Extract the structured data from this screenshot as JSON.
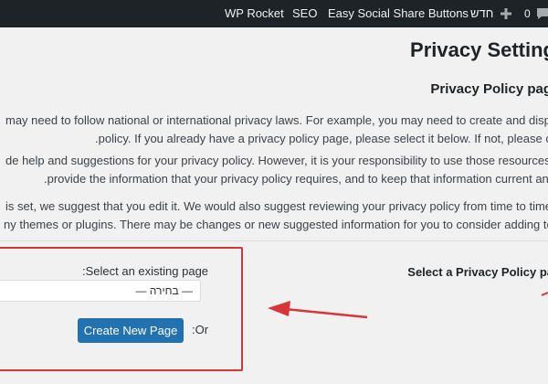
{
  "adminbar": {
    "items": [
      "WP Rocket",
      "SEO",
      "Easy Social Share Buttons",
      "חדש"
    ],
    "comment_count": "0",
    "icons": [
      "plus-icon",
      "comment-bubble-icon"
    ]
  },
  "page": {
    "title": "Privacy Setting",
    "subtitle": "Privacy Policy pag",
    "para1": [
      "may need to follow national or international privacy laws. For example, you may need to create and display a privacy",
      ".policy. If you already have a privacy policy page, please select it below. If not, please create one"
    ],
    "para2": [
      "de help and suggestions for your privacy policy. However, it is your responsibility to use those resources correctly, to",
      ".provide the information that your privacy policy requires, and to keep that information current and accurate"
    ],
    "para3": [
      "is set, we suggest that you edit it. We would also suggest reviewing your privacy policy from time to time, especia",
      "ny themes or plugins. There may be changes or new suggested information for you to consider adding to your polic"
    ]
  },
  "form": {
    "select_heading": "Select a Privacy Policy pa",
    "existing_label": ":Select an existing page",
    "select_value": "— בחירה —",
    "create_button": "Create New Page",
    "or_label": ":Or"
  },
  "colors": {
    "adminbar": "#1d2327",
    "primary": "#2271b1",
    "annotation": "#d63638"
  }
}
